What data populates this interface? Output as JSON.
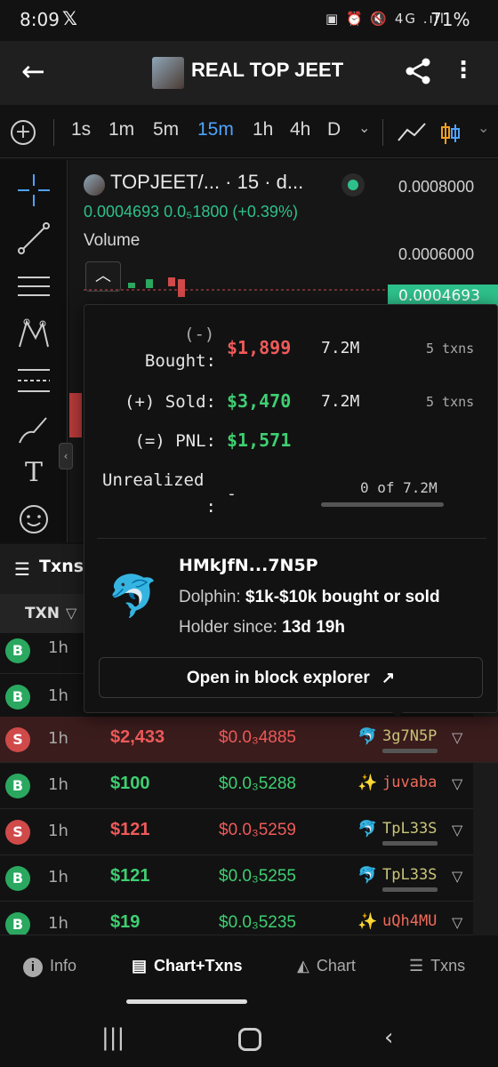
{
  "status_bar": {
    "time": "8:09",
    "x_app": "𝕏",
    "icons": "▣ ⏰ 🔇 4G .ıll",
    "battery": "71%"
  },
  "header": {
    "title": "REAL TOP JEET"
  },
  "toolbar": {
    "timeframes": [
      "1s",
      "1m",
      "5m",
      "15m",
      "1h",
      "4h",
      "D"
    ],
    "active_timeframe": "15m"
  },
  "chart": {
    "pair_label": "TOPJEET/... · 15 · d...",
    "price_line": "0.0004693  0.0₅1800 (+0.39%)",
    "volume_label": "Volume",
    "y_ticks": [
      "0.0008000",
      "0.0006000"
    ],
    "current_price_tag": "0.0004693"
  },
  "popup": {
    "bought_prefix": "(-)",
    "bought_label": "Bought:",
    "bought_value": "$1,899",
    "bought_qty": "7.2M",
    "bought_txns": "5 txns",
    "sold_label": "(+) Sold:",
    "sold_value": "$3,470",
    "sold_qty": "7.2M",
    "sold_txns": "5 txns",
    "pnl_label": "(=) PNL:",
    "pnl_value": "$1,571",
    "unrealized_label": "Unrealized",
    "unrealized_colon": ":",
    "unrealized_value": "-",
    "unrealized_progress": "0 of 7.2M",
    "wallet_address": "HMkJfN...7N5P",
    "tier_label": "Dolphin:",
    "tier_desc": "$1k-$10k bought or sold",
    "holder_label": "Holder since:",
    "holder_since": "13d 19h",
    "explorer_button": "Open in block explorer"
  },
  "txns": {
    "tab_label": "Txns",
    "column_txn": "TXN",
    "rows": [
      {
        "type": "B",
        "age": "1h",
        "amount": "",
        "price": "",
        "maker": ""
      },
      {
        "type": "B",
        "age": "1h",
        "amount": "",
        "price": "",
        "maker": ""
      },
      {
        "type": "S",
        "age": "1h",
        "amount": "$2,433",
        "price": "$0.0₃4885",
        "maker": "3g7N5P"
      },
      {
        "type": "B",
        "age": "1h",
        "amount": "$100",
        "price": "$0.0₃5288",
        "maker": "juvaba"
      },
      {
        "type": "S",
        "age": "1h",
        "amount": "$121",
        "price": "$0.0₃5259",
        "maker": "TpL33S"
      },
      {
        "type": "B",
        "age": "1h",
        "amount": "$121",
        "price": "$0.0₃5255",
        "maker": "TpL33S"
      },
      {
        "type": "B",
        "age": "1h",
        "amount": "$19",
        "price": "$0.0₃5235",
        "maker": "uQh4MU"
      }
    ]
  },
  "bottom_nav": {
    "info": "Info",
    "chart_txns": "Chart+Txns",
    "chart": "Chart",
    "txns": "Txns"
  },
  "colors": {
    "green": "#3fcf72",
    "red": "#ef5a5a",
    "accent": "#4ea3ff",
    "teal": "#2ec08b"
  }
}
